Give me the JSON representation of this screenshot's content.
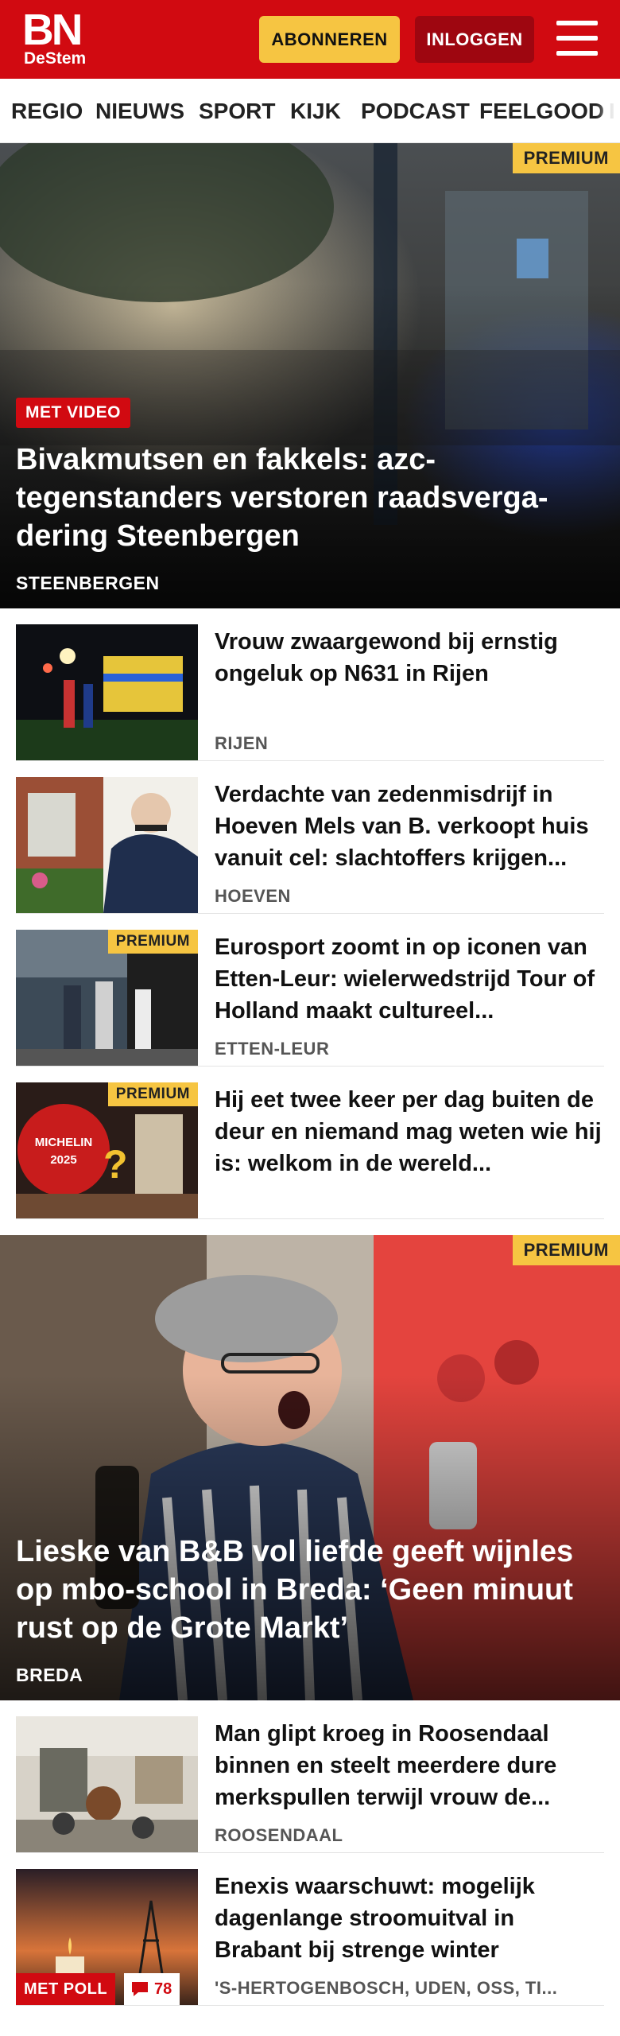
{
  "header": {
    "logo_main": "BN",
    "logo_sub": "DeStem",
    "subscribe_label": "ABONNEREN",
    "login_label": "INLOGGEN",
    "menu_icon": "hamburger-menu-icon",
    "brand_color": "#d10a11",
    "accent_color": "#f6c542"
  },
  "nav": {
    "items": [
      "REGIO",
      "NIEUWS",
      "SPORT",
      "KIJK",
      "PODCAST",
      "FEELGOOD",
      "I"
    ]
  },
  "hero1": {
    "premium": "PREMIUM",
    "badge": "MET VIDEO",
    "title": "Bivakmutsen en fakkels: azc-tegenstanders verstoren raadsverga-dering Steenbergen",
    "location": "STEENBERGEN"
  },
  "articles": [
    {
      "title": "Vrouw zwaargewond bij ernstig ongeluk op N631 in Rijen",
      "location": "RIJEN",
      "premium": ""
    },
    {
      "title": "Verdachte van zedenmisdrijf in Hoeven Mels van B. verkoopt huis vanuit cel: slachtoffers krijgen...",
      "location": "HOEVEN",
      "premium": ""
    },
    {
      "title": "Eurosport zoomt in op iconen van Etten-Leur: wielerwedstrijd Tour of Holland maakt cultureel...",
      "location": "ETTEN-LEUR",
      "premium": "PREMIUM"
    },
    {
      "title": "Hij eet twee keer per dag buiten de deur en niemand mag weten wie hij is: welkom in de wereld...",
      "location": "",
      "premium": "PREMIUM",
      "thumb_text": "MICHELIN 2025"
    }
  ],
  "hero2": {
    "premium": "PREMIUM",
    "title": "Lieske van B&B vol liefde geeft wijnles op mbo-school in Breda: ‘Geen minuut rust op de Grote Markt’",
    "location": "BREDA"
  },
  "articles2": [
    {
      "title": "Man glipt kroeg in Roosendaal binnen en steelt meerdere dure merkspullen terwijl vrouw de...",
      "location": "ROOSENDAAL"
    },
    {
      "title": "Enexis waarschuwt: mogelijk dagenlange stroomuitval in Brabant bij strenge winter",
      "location": "'S-HERTOGENBOSCH, UDEN, OSS, TI...",
      "poll_label": "MET POLL",
      "comment_count": "78",
      "comment_icon": "comment-bubble-icon"
    }
  ]
}
